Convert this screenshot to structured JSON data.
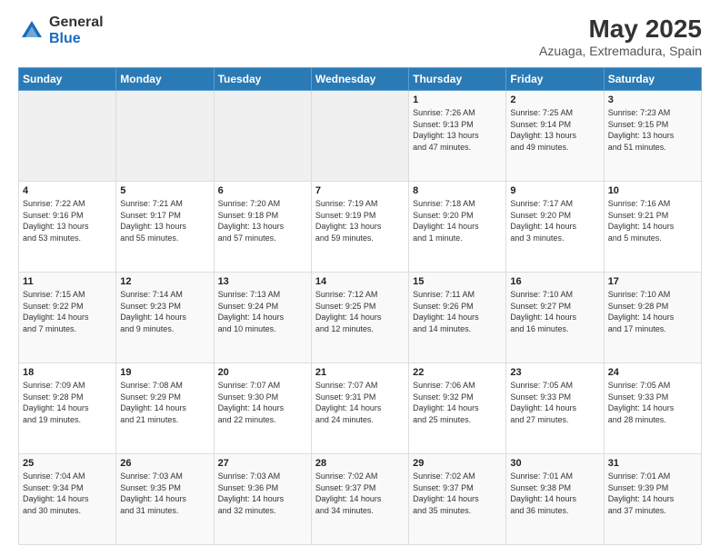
{
  "logo": {
    "general": "General",
    "blue": "Blue"
  },
  "title": "May 2025",
  "subtitle": "Azuaga, Extremadura, Spain",
  "header_days": [
    "Sunday",
    "Monday",
    "Tuesday",
    "Wednesday",
    "Thursday",
    "Friday",
    "Saturday"
  ],
  "weeks": [
    [
      {
        "day": "",
        "info": ""
      },
      {
        "day": "",
        "info": ""
      },
      {
        "day": "",
        "info": ""
      },
      {
        "day": "",
        "info": ""
      },
      {
        "day": "1",
        "info": "Sunrise: 7:26 AM\nSunset: 9:13 PM\nDaylight: 13 hours\nand 47 minutes."
      },
      {
        "day": "2",
        "info": "Sunrise: 7:25 AM\nSunset: 9:14 PM\nDaylight: 13 hours\nand 49 minutes."
      },
      {
        "day": "3",
        "info": "Sunrise: 7:23 AM\nSunset: 9:15 PM\nDaylight: 13 hours\nand 51 minutes."
      }
    ],
    [
      {
        "day": "4",
        "info": "Sunrise: 7:22 AM\nSunset: 9:16 PM\nDaylight: 13 hours\nand 53 minutes."
      },
      {
        "day": "5",
        "info": "Sunrise: 7:21 AM\nSunset: 9:17 PM\nDaylight: 13 hours\nand 55 minutes."
      },
      {
        "day": "6",
        "info": "Sunrise: 7:20 AM\nSunset: 9:18 PM\nDaylight: 13 hours\nand 57 minutes."
      },
      {
        "day": "7",
        "info": "Sunrise: 7:19 AM\nSunset: 9:19 PM\nDaylight: 13 hours\nand 59 minutes."
      },
      {
        "day": "8",
        "info": "Sunrise: 7:18 AM\nSunset: 9:20 PM\nDaylight: 14 hours\nand 1 minute."
      },
      {
        "day": "9",
        "info": "Sunrise: 7:17 AM\nSunset: 9:20 PM\nDaylight: 14 hours\nand 3 minutes."
      },
      {
        "day": "10",
        "info": "Sunrise: 7:16 AM\nSunset: 9:21 PM\nDaylight: 14 hours\nand 5 minutes."
      }
    ],
    [
      {
        "day": "11",
        "info": "Sunrise: 7:15 AM\nSunset: 9:22 PM\nDaylight: 14 hours\nand 7 minutes."
      },
      {
        "day": "12",
        "info": "Sunrise: 7:14 AM\nSunset: 9:23 PM\nDaylight: 14 hours\nand 9 minutes."
      },
      {
        "day": "13",
        "info": "Sunrise: 7:13 AM\nSunset: 9:24 PM\nDaylight: 14 hours\nand 10 minutes."
      },
      {
        "day": "14",
        "info": "Sunrise: 7:12 AM\nSunset: 9:25 PM\nDaylight: 14 hours\nand 12 minutes."
      },
      {
        "day": "15",
        "info": "Sunrise: 7:11 AM\nSunset: 9:26 PM\nDaylight: 14 hours\nand 14 minutes."
      },
      {
        "day": "16",
        "info": "Sunrise: 7:10 AM\nSunset: 9:27 PM\nDaylight: 14 hours\nand 16 minutes."
      },
      {
        "day": "17",
        "info": "Sunrise: 7:10 AM\nSunset: 9:28 PM\nDaylight: 14 hours\nand 17 minutes."
      }
    ],
    [
      {
        "day": "18",
        "info": "Sunrise: 7:09 AM\nSunset: 9:28 PM\nDaylight: 14 hours\nand 19 minutes."
      },
      {
        "day": "19",
        "info": "Sunrise: 7:08 AM\nSunset: 9:29 PM\nDaylight: 14 hours\nand 21 minutes."
      },
      {
        "day": "20",
        "info": "Sunrise: 7:07 AM\nSunset: 9:30 PM\nDaylight: 14 hours\nand 22 minutes."
      },
      {
        "day": "21",
        "info": "Sunrise: 7:07 AM\nSunset: 9:31 PM\nDaylight: 14 hours\nand 24 minutes."
      },
      {
        "day": "22",
        "info": "Sunrise: 7:06 AM\nSunset: 9:32 PM\nDaylight: 14 hours\nand 25 minutes."
      },
      {
        "day": "23",
        "info": "Sunrise: 7:05 AM\nSunset: 9:33 PM\nDaylight: 14 hours\nand 27 minutes."
      },
      {
        "day": "24",
        "info": "Sunrise: 7:05 AM\nSunset: 9:33 PM\nDaylight: 14 hours\nand 28 minutes."
      }
    ],
    [
      {
        "day": "25",
        "info": "Sunrise: 7:04 AM\nSunset: 9:34 PM\nDaylight: 14 hours\nand 30 minutes."
      },
      {
        "day": "26",
        "info": "Sunrise: 7:03 AM\nSunset: 9:35 PM\nDaylight: 14 hours\nand 31 minutes."
      },
      {
        "day": "27",
        "info": "Sunrise: 7:03 AM\nSunset: 9:36 PM\nDaylight: 14 hours\nand 32 minutes."
      },
      {
        "day": "28",
        "info": "Sunrise: 7:02 AM\nSunset: 9:37 PM\nDaylight: 14 hours\nand 34 minutes."
      },
      {
        "day": "29",
        "info": "Sunrise: 7:02 AM\nSunset: 9:37 PM\nDaylight: 14 hours\nand 35 minutes."
      },
      {
        "day": "30",
        "info": "Sunrise: 7:01 AM\nSunset: 9:38 PM\nDaylight: 14 hours\nand 36 minutes."
      },
      {
        "day": "31",
        "info": "Sunrise: 7:01 AM\nSunset: 9:39 PM\nDaylight: 14 hours\nand 37 minutes."
      }
    ]
  ]
}
